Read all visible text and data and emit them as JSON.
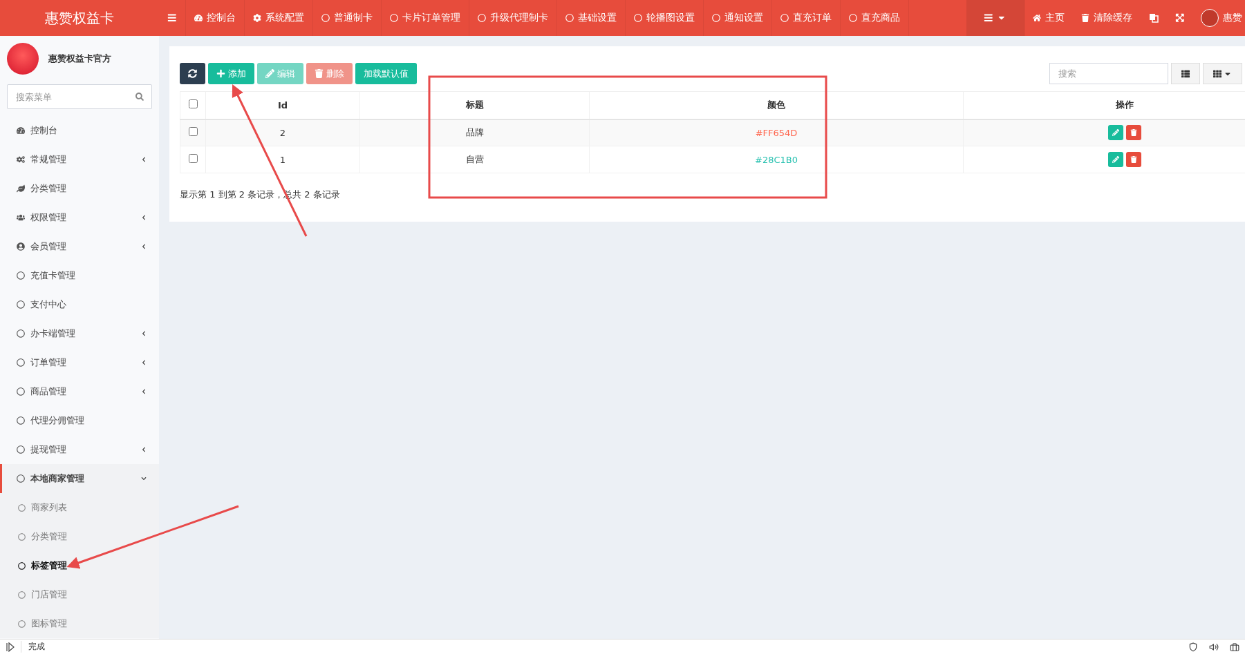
{
  "topbar": {
    "brand": "惠赞权益卡",
    "nav": [
      {
        "label": "控制台",
        "kind": "dashboard"
      },
      {
        "label": "系统配置",
        "kind": "gear"
      },
      {
        "label": "普通制卡",
        "kind": "circle"
      },
      {
        "label": "卡片订单管理",
        "kind": "circle"
      },
      {
        "label": "升级代理制卡",
        "kind": "circle"
      },
      {
        "label": "基础设置",
        "kind": "circle"
      },
      {
        "label": "轮播图设置",
        "kind": "circle"
      },
      {
        "label": "通知设置",
        "kind": "circle"
      },
      {
        "label": "直充订单",
        "kind": "circle"
      },
      {
        "label": "直充商品",
        "kind": "circle"
      }
    ],
    "right": [
      {
        "label": "主页",
        "kind": "home"
      },
      {
        "label": "清除缓存",
        "kind": "trash"
      }
    ],
    "user": "惠赞"
  },
  "sidebar": {
    "name": "惠赞权益卡官方",
    "search": {
      "placeholder": "搜索菜单"
    },
    "items": [
      {
        "label": "控制台",
        "kind": "dashboard",
        "selected": false
      },
      {
        "label": "常规管理",
        "kind": "gears",
        "expanded": false,
        "selected": false
      },
      {
        "label": "分类管理",
        "kind": "leaf",
        "selected": false
      },
      {
        "label": "权限管理",
        "kind": "users",
        "expanded": false,
        "selected": false
      },
      {
        "label": "会员管理",
        "kind": "user",
        "expanded": false,
        "selected": false
      },
      {
        "label": "充值卡管理",
        "kind": "circle",
        "selected": false
      },
      {
        "label": "支付中心",
        "kind": "circle",
        "selected": false
      },
      {
        "label": "办卡端管理",
        "kind": "circle",
        "expanded": false,
        "selected": false
      },
      {
        "label": "订单管理",
        "kind": "circle",
        "expanded": false,
        "selected": false
      },
      {
        "label": "商品管理",
        "kind": "circle",
        "expanded": false,
        "selected": false
      },
      {
        "label": "代理分佣管理",
        "kind": "circle",
        "selected": false
      },
      {
        "label": "提现管理",
        "kind": "circle",
        "expanded": false,
        "selected": false
      },
      {
        "label": "本地商家管理",
        "kind": "circle",
        "expanded": true,
        "selected": true,
        "children": [
          {
            "label": "商家列表",
            "selected": false
          },
          {
            "label": "分类管理",
            "selected": false
          },
          {
            "label": "标签管理",
            "selected": true
          },
          {
            "label": "门店管理",
            "selected": false
          },
          {
            "label": "图标管理",
            "selected": false
          }
        ]
      }
    ]
  },
  "toolbar": {
    "buttons": [
      {
        "kind": "refresh",
        "disabled": false
      },
      {
        "kind": "add",
        "label": "添加",
        "disabled": false
      },
      {
        "kind": "edit",
        "label": "编辑",
        "disabled": true
      },
      {
        "kind": "delete",
        "label": "删除",
        "disabled": true
      },
      {
        "kind": "default",
        "label": "加载默认值",
        "disabled": false
      }
    ],
    "search": {
      "placeholder": "搜索"
    }
  },
  "table": {
    "select_all_checked": false,
    "columns": [
      "Id",
      "标题",
      "颜色",
      "操作"
    ],
    "rows": [
      {
        "id": "2",
        "title": "品牌",
        "color_text": "#FF654D",
        "color": "#ff654d",
        "checked": false
      },
      {
        "id": "1",
        "title": "自营",
        "color_text": "#28C1B0",
        "color": "#28c1b0",
        "checked": false
      }
    ],
    "summary": "显示第 1 到第 2 条记录，总共 2 条记录"
  },
  "status_bar": {
    "text": "完成"
  }
}
